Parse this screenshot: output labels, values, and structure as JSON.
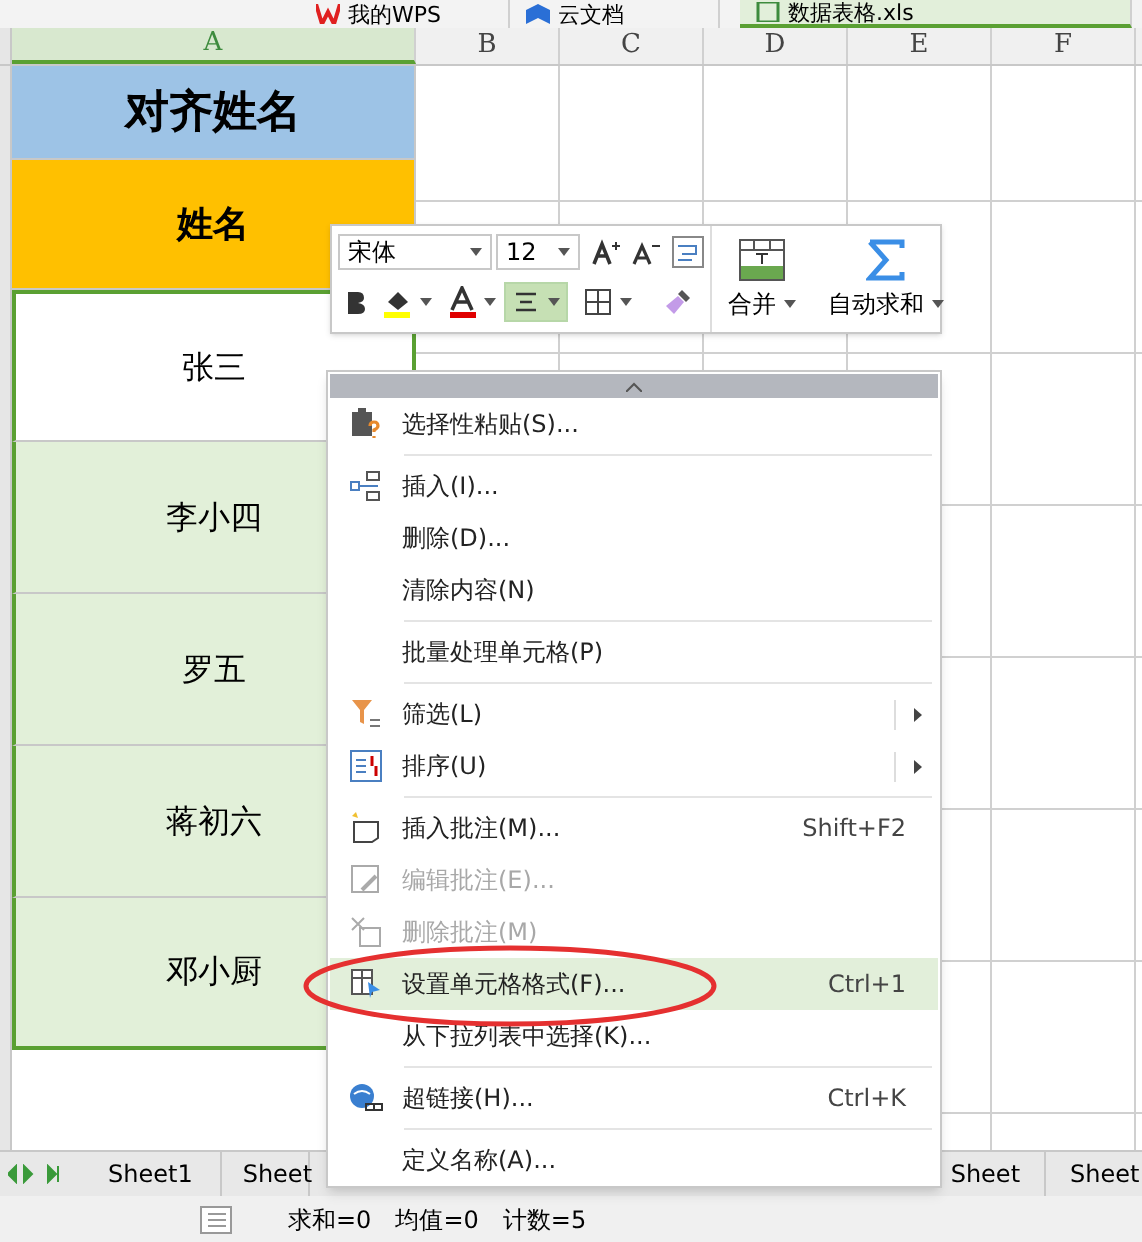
{
  "doc_tabs": [
    {
      "label": "我的WPS",
      "selected": false
    },
    {
      "label": "云文档",
      "selected": false
    },
    {
      "label": "数据表格.xls",
      "selected": true
    }
  ],
  "columns": [
    {
      "label": "A",
      "selected": true
    },
    {
      "label": "B",
      "selected": false
    },
    {
      "label": "C",
      "selected": false
    },
    {
      "label": "D",
      "selected": false
    },
    {
      "label": "E",
      "selected": false
    },
    {
      "label": "F",
      "selected": false
    }
  ],
  "cells": [
    {
      "text": "对齐姓名",
      "kind": "title",
      "color": "#9dc3e6"
    },
    {
      "text": "姓名",
      "kind": "header",
      "color": "#ffc000"
    },
    {
      "text": "张三",
      "kind": "name",
      "selected": true
    },
    {
      "text": "李小四",
      "kind": "name",
      "selected": true
    },
    {
      "text": "罗五",
      "kind": "name",
      "selected": true
    },
    {
      "text": "蒋初六",
      "kind": "name",
      "selected": true
    },
    {
      "text": "邓小厨",
      "kind": "name",
      "selected": true
    }
  ],
  "mini_toolbar": {
    "font": "宋体",
    "size": "12",
    "merge": "合并",
    "autosum": "自动求和",
    "align_selected": true
  },
  "context_menu": [
    {
      "label": "选择性粘贴(S)...",
      "disabled": false,
      "selected": false,
      "divider": true
    },
    {
      "label": "插入(I)...",
      "disabled": false,
      "selected": false
    },
    {
      "label": "删除(D)...",
      "disabled": false,
      "selected": false
    },
    {
      "label": "清除内容(N)",
      "disabled": false,
      "selected": false,
      "divider": true
    },
    {
      "label": "批量处理单元格(P)",
      "disabled": false,
      "selected": false,
      "divider": true
    },
    {
      "label": "筛选(L)",
      "submenu": true,
      "disabled": false,
      "selected": false
    },
    {
      "label": "排序(U)",
      "submenu": true,
      "disabled": false,
      "selected": false,
      "divider": true
    },
    {
      "label": "插入批注(M)...",
      "shortcut": "Shift+F2",
      "disabled": false,
      "selected": false
    },
    {
      "label": "编辑批注(E)...",
      "disabled": true,
      "selected": false
    },
    {
      "label": "删除批注(M)",
      "disabled": true,
      "selected": false
    },
    {
      "label": "设置单元格格式(F)...",
      "shortcut": "Ctrl+1",
      "disabled": false,
      "selected": true,
      "circled": true
    },
    {
      "label": "从下拉列表中选择(K)...",
      "disabled": false,
      "selected": false,
      "divider": true
    },
    {
      "label": "超链接(H)...",
      "shortcut": "Ctrl+K",
      "disabled": false,
      "selected": false,
      "divider": true
    },
    {
      "label": "定义名称(A)...",
      "disabled": false,
      "selected": false
    }
  ],
  "sheet_tabs": [
    "Sheet1",
    "Sheet",
    "Sheet",
    "Sheet"
  ],
  "status": [
    "求和=0",
    "均值=0",
    "计数=5"
  ]
}
